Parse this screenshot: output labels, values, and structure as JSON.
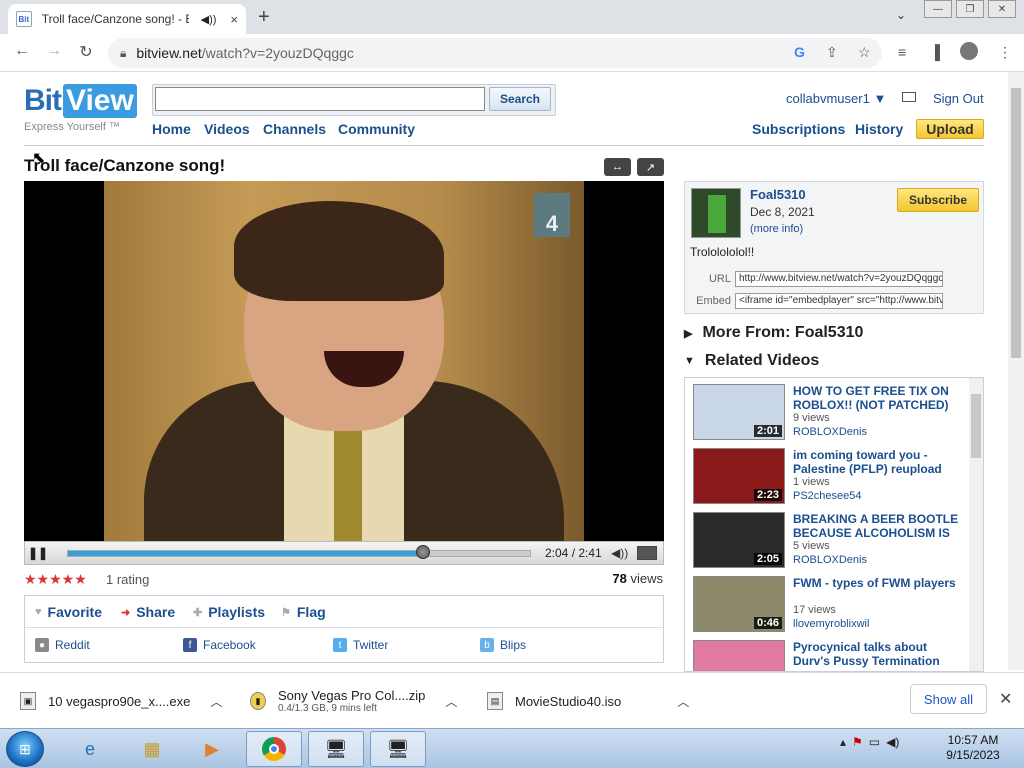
{
  "browser": {
    "tab_title": "Troll face/Canzone song! - B",
    "url_host": "bitview.net",
    "url_path": "/watch?v=2youzDQqggc",
    "new_tab": "+",
    "close_tab": "×"
  },
  "site": {
    "logo_bit": "Bit",
    "logo_view": "View",
    "tagline": "Express Yourself ™",
    "search_placeholder": "",
    "search_label": "Search",
    "nav": [
      "Home",
      "Videos",
      "Channels",
      "Community"
    ],
    "username": "collabvmuser1",
    "signout": "Sign Out",
    "subscriptions": "Subscriptions",
    "history": "History",
    "upload": "Upload"
  },
  "video": {
    "title": "Troll face/Canzone song!",
    "channel_number": "4",
    "time": "2:04 / 2:41",
    "progress": 0.77,
    "stars": "★★★★★",
    "rating_count": "1 rating",
    "views_num": "78",
    "views_label": " views"
  },
  "actions": {
    "favorite": "Favorite",
    "share": "Share",
    "playlists": "Playlists",
    "flag": "Flag",
    "share_links": [
      "Reddit",
      "Facebook",
      "Twitter",
      "Blips"
    ]
  },
  "channel": {
    "name": "Foal5310",
    "date": "Dec 8, 2021",
    "more_info": "(more info)",
    "subscribe": "Subscribe",
    "description": "Trololololol!!",
    "url_label": "URL",
    "url_value": "http://www.bitview.net/watch?v=2youzDQqggc",
    "embed_label": "Embed",
    "embed_value": "<iframe id=\"embedplayer\" src=\"http://www.bitview.net"
  },
  "sections": {
    "more_from": "More From: Foal5310",
    "related": "Related Videos"
  },
  "related_videos": [
    {
      "title": "HOW TO GET FREE TIX ON ROBLOX!! (NOT PATCHED)",
      "views": "9 views",
      "author": "ROBLOXDenis",
      "duration": "2:01",
      "color": "#c9d6e8"
    },
    {
      "title": "im coming toward you - Palestine (PFLP) reupload",
      "views": "1 views",
      "author": "PS2chesee54",
      "duration": "2:23",
      "color": "#8a1a1a"
    },
    {
      "title": "BREAKING A BEER BOOTLE BECAUSE ALCOHOLISM IS",
      "views": "5 views",
      "author": "ROBLOXDenis",
      "duration": "2:05",
      "color": "#2a2a2a"
    },
    {
      "title": "FWM - types of FWM players",
      "views": "17 views",
      "author": "llovemyroblixwil",
      "duration": "0:46",
      "color": "#8c8a6a"
    },
    {
      "title": "Pyrocynical talks about Durv's Pussy Termination",
      "views": "",
      "author": "",
      "duration": "",
      "color": "#e07aa0"
    }
  ],
  "downloads": [
    {
      "name": "10 vegaspro90e_x....exe",
      "status": ""
    },
    {
      "name": "Sony Vegas Pro Col....zip",
      "status": "0.4/1.3 GB, 9 mins left"
    },
    {
      "name": "MovieStudio40.iso",
      "status": ""
    }
  ],
  "downloads_show_all": "Show all",
  "taskbar": {
    "time": "10:57 AM",
    "date": "9/15/2023"
  }
}
